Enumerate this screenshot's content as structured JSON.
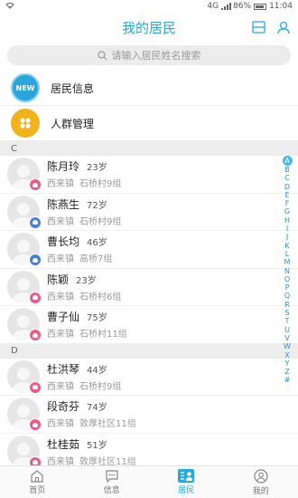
{
  "status_bar": {
    "signal_text": "4G",
    "battery_text": "86%",
    "time": "11:04"
  },
  "header": {
    "title": "我的居民",
    "icons": [
      "scan-icon",
      "user-icon"
    ]
  },
  "search": {
    "placeholder": "请输入居民姓名搜索"
  },
  "menu": [
    {
      "icon": "new-badge-icon",
      "icon_text": "NEW",
      "label": "居民信息",
      "icon_color": "#2aa6dd"
    },
    {
      "icon": "crowd-icon",
      "label": "人群管理",
      "icon_color": "#f1b21b"
    }
  ],
  "sections": [
    {
      "letter": "C",
      "residents": [
        {
          "name": "陈月玲",
          "age": "23岁",
          "town": "西来镇",
          "village": "石桥村9组",
          "gender": "female"
        },
        {
          "name": "陈燕生",
          "age": "72岁",
          "town": "西来镇",
          "village": "石桥村9组",
          "gender": "male"
        },
        {
          "name": "曹长均",
          "age": "46岁",
          "town": "西来镇",
          "village": "高桥7组",
          "gender": "male"
        },
        {
          "name": "陈颖",
          "age": "23岁",
          "town": "西来镇",
          "village": "石桥村6组",
          "gender": "female"
        },
        {
          "name": "曹子仙",
          "age": "75岁",
          "town": "西来镇",
          "village": "石桥村11组",
          "gender": "female"
        }
      ]
    },
    {
      "letter": "D",
      "residents": [
        {
          "name": "杜洪琴",
          "age": "44岁",
          "town": "西来镇",
          "village": "石桥村9组",
          "gender": "female"
        },
        {
          "name": "段奇芬",
          "age": "74岁",
          "town": "西来镇",
          "village": "敦厚社区11组",
          "gender": "female"
        },
        {
          "name": "杜桂茹",
          "age": "51岁",
          "town": "西来镇",
          "village": "敦厚社区11组",
          "gender": "female"
        }
      ]
    }
  ],
  "alphabet": [
    "A",
    "B",
    "C",
    "D",
    "E",
    "F",
    "G",
    "H",
    "I",
    "J",
    "K",
    "L",
    "M",
    "N",
    "O",
    "P",
    "Q",
    "R",
    "S",
    "T",
    "U",
    "V",
    "W",
    "X",
    "Y",
    "Z",
    "#"
  ],
  "alphabet_active": "A",
  "bottom_nav": [
    {
      "label": "首页",
      "icon": "home-icon"
    },
    {
      "label": "信息",
      "icon": "message-icon"
    },
    {
      "label": "居民",
      "icon": "residents-icon",
      "active": true
    },
    {
      "label": "我的",
      "icon": "profile-icon"
    }
  ],
  "colors": {
    "accent": "#29a8e4",
    "female": "#ef5a87",
    "male": "#4b7fd8"
  }
}
